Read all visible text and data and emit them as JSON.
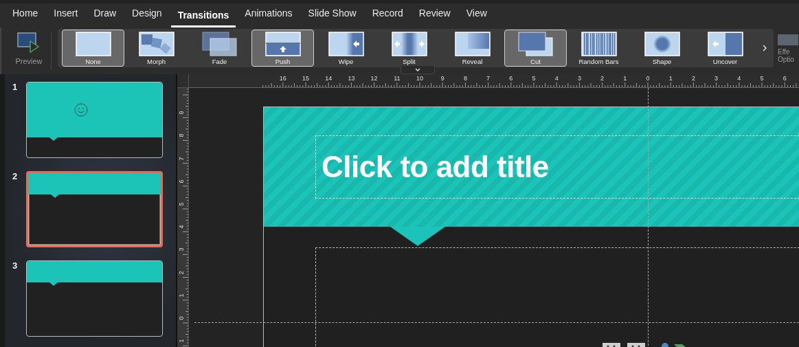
{
  "tabs": [
    {
      "label": "Home",
      "selected": false
    },
    {
      "label": "Insert",
      "selected": false
    },
    {
      "label": "Draw",
      "selected": false
    },
    {
      "label": "Design",
      "selected": false
    },
    {
      "label": "Transitions",
      "selected": true
    },
    {
      "label": "Animations",
      "selected": false
    },
    {
      "label": "Slide Show",
      "selected": false
    },
    {
      "label": "Record",
      "selected": false
    },
    {
      "label": "Review",
      "selected": false
    },
    {
      "label": "View",
      "selected": false
    }
  ],
  "preview": {
    "label": "Preview"
  },
  "transitions": [
    {
      "label": "None",
      "kind": "none",
      "selected": true
    },
    {
      "label": "Morph",
      "kind": "morph",
      "selected": false
    },
    {
      "label": "Fade",
      "kind": "fade",
      "selected": false
    },
    {
      "label": "Push",
      "kind": "push",
      "selected": true
    },
    {
      "label": "Wipe",
      "kind": "wipe",
      "selected": false
    },
    {
      "label": "Split",
      "kind": "split",
      "selected": false
    },
    {
      "label": "Reveal",
      "kind": "reveal",
      "selected": false
    },
    {
      "label": "Cut",
      "kind": "cut",
      "selected": true
    },
    {
      "label": "Random Bars",
      "kind": "bars",
      "selected": false
    },
    {
      "label": "Shape",
      "kind": "shape",
      "selected": false
    },
    {
      "label": "Uncover",
      "kind": "uncover",
      "selected": false
    }
  ],
  "effect_options": {
    "label_lines": [
      "Effe",
      "Optio"
    ]
  },
  "slides": [
    {
      "number": "1",
      "selected": false,
      "smiley": true
    },
    {
      "number": "2",
      "selected": true,
      "smiley": false
    },
    {
      "number": "3",
      "selected": false,
      "smiley": false
    }
  ],
  "rulers": {
    "horizontal": [
      "16",
      "15",
      "14",
      "13",
      "12",
      "11",
      "10",
      "9",
      "8",
      "7",
      "6",
      "5",
      "4",
      "3",
      "2",
      "1",
      "0",
      "1",
      "2",
      "3",
      "4",
      "5",
      "6"
    ],
    "vertical": [
      "9",
      "8",
      "7",
      "6",
      "5",
      "4",
      "3",
      "2",
      "1",
      "0",
      "1"
    ]
  },
  "slide": {
    "title_placeholder": "Click to add title"
  }
}
